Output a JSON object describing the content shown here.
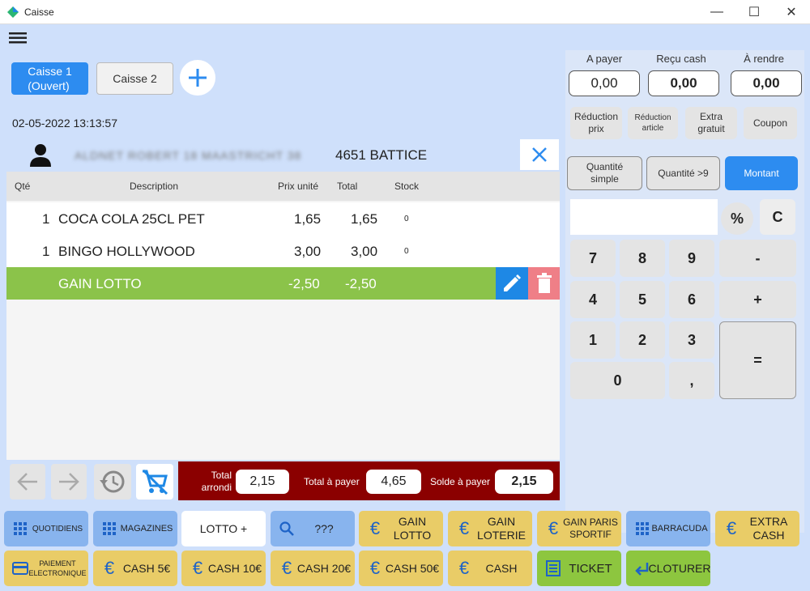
{
  "window": {
    "title": "Caisse",
    "minimize": "—",
    "maximize": "☐",
    "close": "✕"
  },
  "tabs": [
    {
      "label": "Caisse 1\n(Ouvert)"
    },
    {
      "label": "Caisse 2"
    }
  ],
  "add_tab": "+",
  "datetime": "02-05-2022 13:13:57",
  "customer": {
    "name": "ALDNET ROBERT 18 MAASTRICHT 38",
    "city": "4651 BATTICE"
  },
  "table": {
    "headers": {
      "qty": "Qté",
      "desc": "Description",
      "price": "Prix unité",
      "total": "Total",
      "stock": "Stock"
    },
    "rows": [
      {
        "qty": "1",
        "desc": "COCA COLA 25CL PET",
        "price": "1,65",
        "total": "1,65",
        "stock": "0"
      },
      {
        "qty": "1",
        "desc": "BINGO HOLLYWOOD",
        "price": "3,00",
        "total": "3,00",
        "stock": "0"
      },
      {
        "qty": "",
        "desc": "GAIN LOTTO",
        "price": "-2,50",
        "total": "-2,50",
        "stock": ""
      }
    ]
  },
  "totals": {
    "rounded_label": "Total\narrondi",
    "rounded_value": "2,15",
    "to_pay_label": "Total à payer",
    "to_pay_value": "4,65",
    "balance_label": "Solde à payer",
    "balance_value": "2,15"
  },
  "payment": {
    "to_pay_label": "A payer",
    "to_pay_value": "0,00",
    "cash_label": "Reçu cash",
    "cash_value": "0,00",
    "change_label": "À rendre",
    "change_value": "0,00"
  },
  "discounts": {
    "price": "Réduction\nprix",
    "article": "Réduction\narticle",
    "free": "Extra\ngratuit",
    "coupon": "Coupon"
  },
  "modes": {
    "simple": "Quantité\nsimple",
    "more": "Quantité >9",
    "amount": "Montant"
  },
  "keypad": {
    "percent": "%",
    "clear": "C",
    "k7": "7",
    "k8": "8",
    "k9": "9",
    "minus": "-",
    "k4": "4",
    "k5": "5",
    "k6": "6",
    "plus": "+",
    "k1": "1",
    "k2": "2",
    "k3": "3",
    "equals": "=",
    "k0": "0",
    "comma": ","
  },
  "buttons_row1": {
    "quotidiens": "QUOTIDIENS",
    "magazines": "MAGAZINES",
    "lotto": "LOTTO +",
    "search": "???",
    "gain_lotto": "GAIN\nLOTTO",
    "gain_loterie": "GAIN\nLOTERIE",
    "gain_paris": "GAIN PARIS\nSPORTIF",
    "barracuda": "BARRACUDA",
    "extra_cash": "EXTRA\nCASH"
  },
  "buttons_row2": {
    "paiement": "PAIEMENT\nELECTRONIQUE",
    "cash5": "CASH 5€",
    "cash10": "CASH 10€",
    "cash20": "CASH 20€",
    "cash50": "CASH 50€",
    "cash": "CASH",
    "ticket": "TICKET",
    "cloturer": "CLOTURER"
  },
  "colors": {
    "accent_blue": "#2d8cf0",
    "selected_row": "#8bc34a",
    "dark_red": "#8b0000",
    "yellow": "#e9cc67",
    "green": "#8dc63f"
  }
}
